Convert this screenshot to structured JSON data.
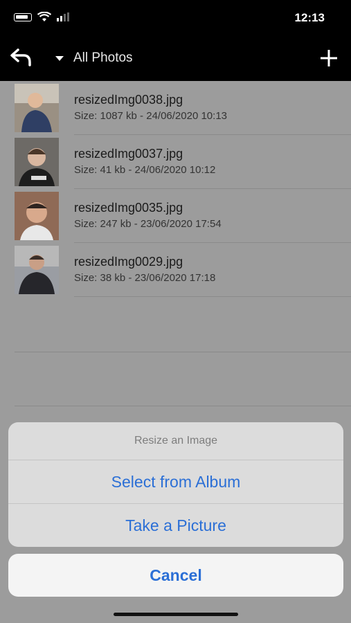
{
  "status": {
    "time": "12:13"
  },
  "navbar": {
    "title": "All Photos",
    "back_icon": "back-arrow-icon",
    "dropdown_icon": "caret-down-icon",
    "add_icon": "plus-icon"
  },
  "files": [
    {
      "name": "resizedImg0038.jpg",
      "meta": "Size: 1087 kb - 24/06/2020 10:13",
      "thumb_bg": "#9a9083"
    },
    {
      "name": "resizedImg0037.jpg",
      "meta": "Size: 41 kb - 24/06/2020 10:12",
      "thumb_bg": "#6d6a66"
    },
    {
      "name": "resizedImg0035.jpg",
      "meta": "Size: 247 kb - 23/06/2020 17:54",
      "thumb_bg": "#8f6a56"
    },
    {
      "name": "resizedImg0029.jpg",
      "meta": "Size: 38 kb - 23/06/2020 17:18",
      "thumb_bg": "#b8b8b8"
    }
  ],
  "action_sheet": {
    "title": "Resize an Image",
    "options": [
      "Select from Album",
      "Take a Picture"
    ],
    "cancel": "Cancel"
  },
  "colors": {
    "accent": "#2b6fd6",
    "bar": "#000000",
    "background": "#9c9c9c"
  }
}
